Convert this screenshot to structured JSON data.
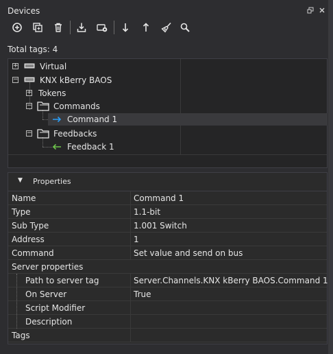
{
  "window": {
    "title": "Devices"
  },
  "toolbar": {
    "buttons": [
      {
        "name": "add-device-button",
        "icon": "plus-circle-icon"
      },
      {
        "name": "duplicate-button",
        "icon": "duplicate-icon"
      },
      {
        "name": "delete-button",
        "icon": "trash-icon"
      },
      {
        "name": "import-button",
        "icon": "download-tray-icon"
      },
      {
        "name": "connect-device-button",
        "icon": "device-gear-icon"
      },
      {
        "name": "move-down-button",
        "icon": "arrow-down-icon"
      },
      {
        "name": "move-up-button",
        "icon": "arrow-up-icon"
      },
      {
        "name": "clean-button",
        "icon": "broom-icon"
      },
      {
        "name": "search-button",
        "icon": "magnifier-icon"
      }
    ]
  },
  "total_tags": "Total tags: 4",
  "tree": {
    "virtual": "Virtual",
    "knx": "KNX kBerry BAOS",
    "tokens": "Tokens",
    "commands": "Commands",
    "command1": "Command 1",
    "feedbacks": "Feedbacks",
    "feedback1": "Feedback 1"
  },
  "properties": {
    "header": "Properties",
    "rows": [
      {
        "key": "Name",
        "value": "Command 1"
      },
      {
        "key": "Type",
        "value": "1.1-bit"
      },
      {
        "key": "Sub Type",
        "value": "1.001 Switch"
      },
      {
        "key": "Address",
        "value": "1"
      },
      {
        "key": "Command",
        "value": "Set value and send on bus"
      },
      {
        "key": "Server properties",
        "value": ""
      },
      {
        "key": "Path to server tag",
        "value": "Server.Channels.KNX kBerry BAOS.Command 1"
      },
      {
        "key": "On Server",
        "value": "True"
      },
      {
        "key": "Script Modifier",
        "value": ""
      },
      {
        "key": "Description",
        "value": ""
      },
      {
        "key": "Tags",
        "value": ""
      }
    ]
  },
  "colors": {
    "background": "#2d2d30",
    "panel": "#252526",
    "selected": "#3a3a3d",
    "command_arrow": "#2a9df4",
    "feedback_arrow": "#6cc24a"
  }
}
